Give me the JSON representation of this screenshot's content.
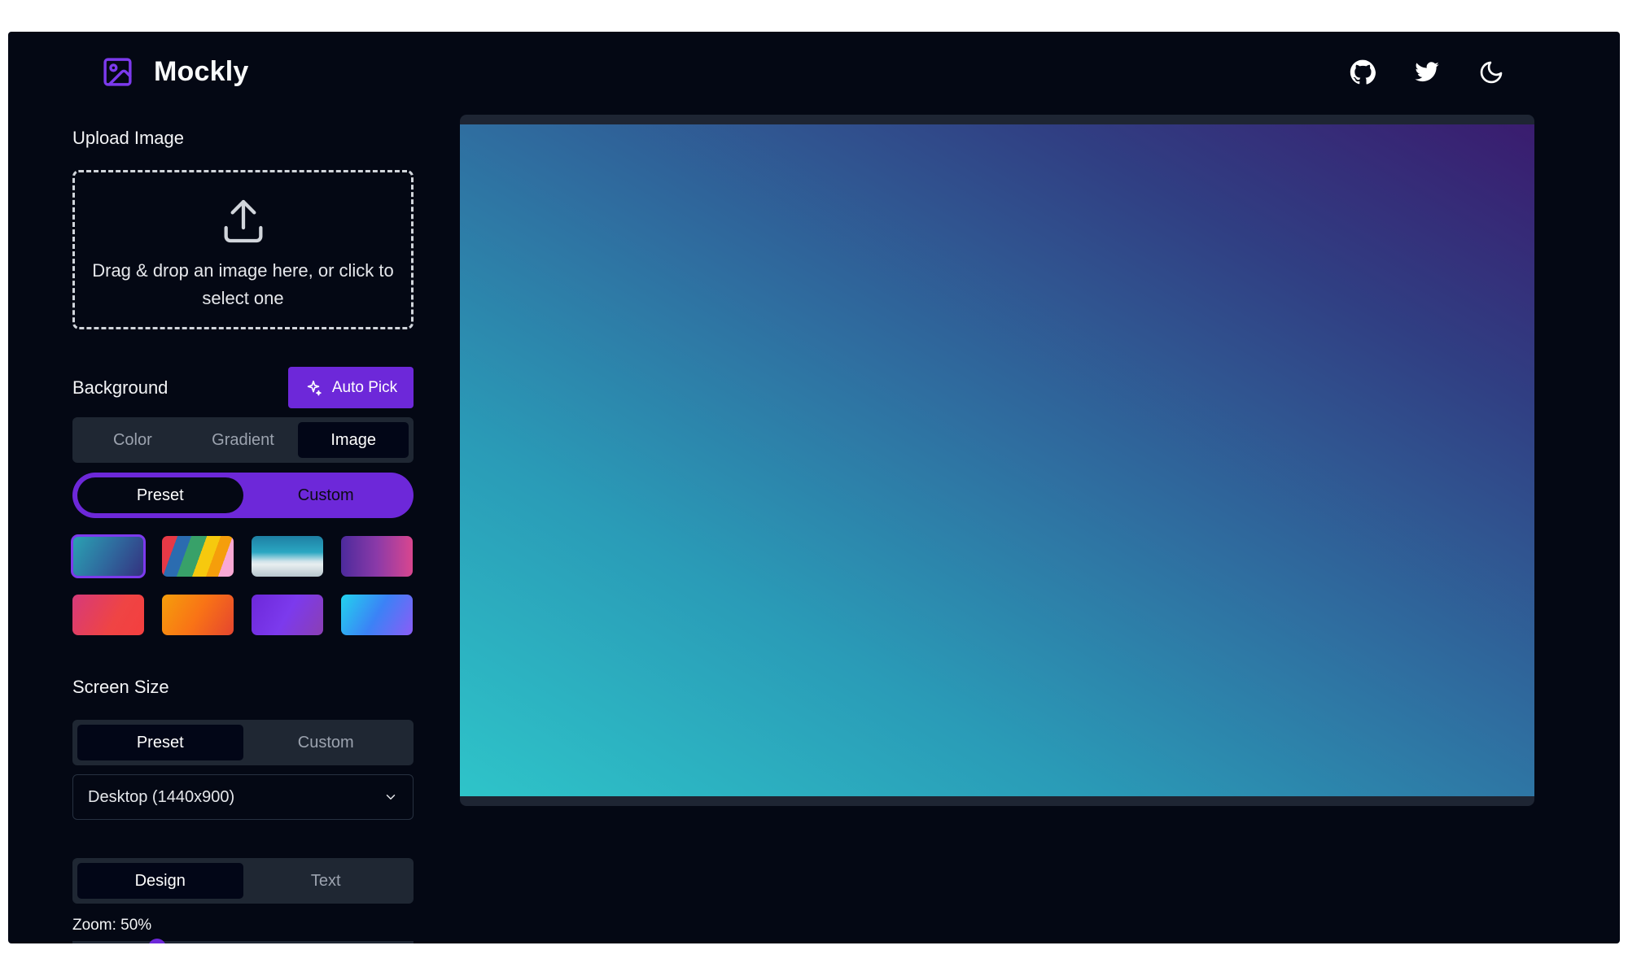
{
  "app": {
    "brand": "Mockly"
  },
  "header": {
    "icons": [
      "github-icon",
      "twitter-icon",
      "moon-icon"
    ]
  },
  "upload": {
    "title": "Upload Image",
    "dropzone_text": "Drag & drop an image here, or click to select one"
  },
  "background": {
    "title": "Background",
    "auto_pick_label": "Auto Pick",
    "type_tabs": [
      "Color",
      "Gradient",
      "Image"
    ],
    "active_type": "Image",
    "source_tabs": [
      "Preset",
      "Custom"
    ],
    "active_source": "Preset",
    "swatches": [
      {
        "name": "teal-indigo",
        "selected": true
      },
      {
        "name": "colorful-stripes",
        "selected": false
      },
      {
        "name": "ocean-beach",
        "selected": false
      },
      {
        "name": "purple-pink",
        "selected": false
      },
      {
        "name": "pink-red",
        "selected": false
      },
      {
        "name": "orange-red",
        "selected": false
      },
      {
        "name": "purple",
        "selected": false
      },
      {
        "name": "cyan-violet",
        "selected": false
      }
    ]
  },
  "screen_size": {
    "title": "Screen Size",
    "tabs": [
      "Preset",
      "Custom"
    ],
    "active": "Preset",
    "selected_preset": "Desktop (1440x900)"
  },
  "panel_tabs": {
    "tabs": [
      "Design",
      "Text"
    ],
    "active": "Design"
  },
  "zoom": {
    "label": "Zoom: 50%",
    "value_percent": 50
  },
  "colors": {
    "accent": "#6d28d9",
    "background": "#040814"
  }
}
